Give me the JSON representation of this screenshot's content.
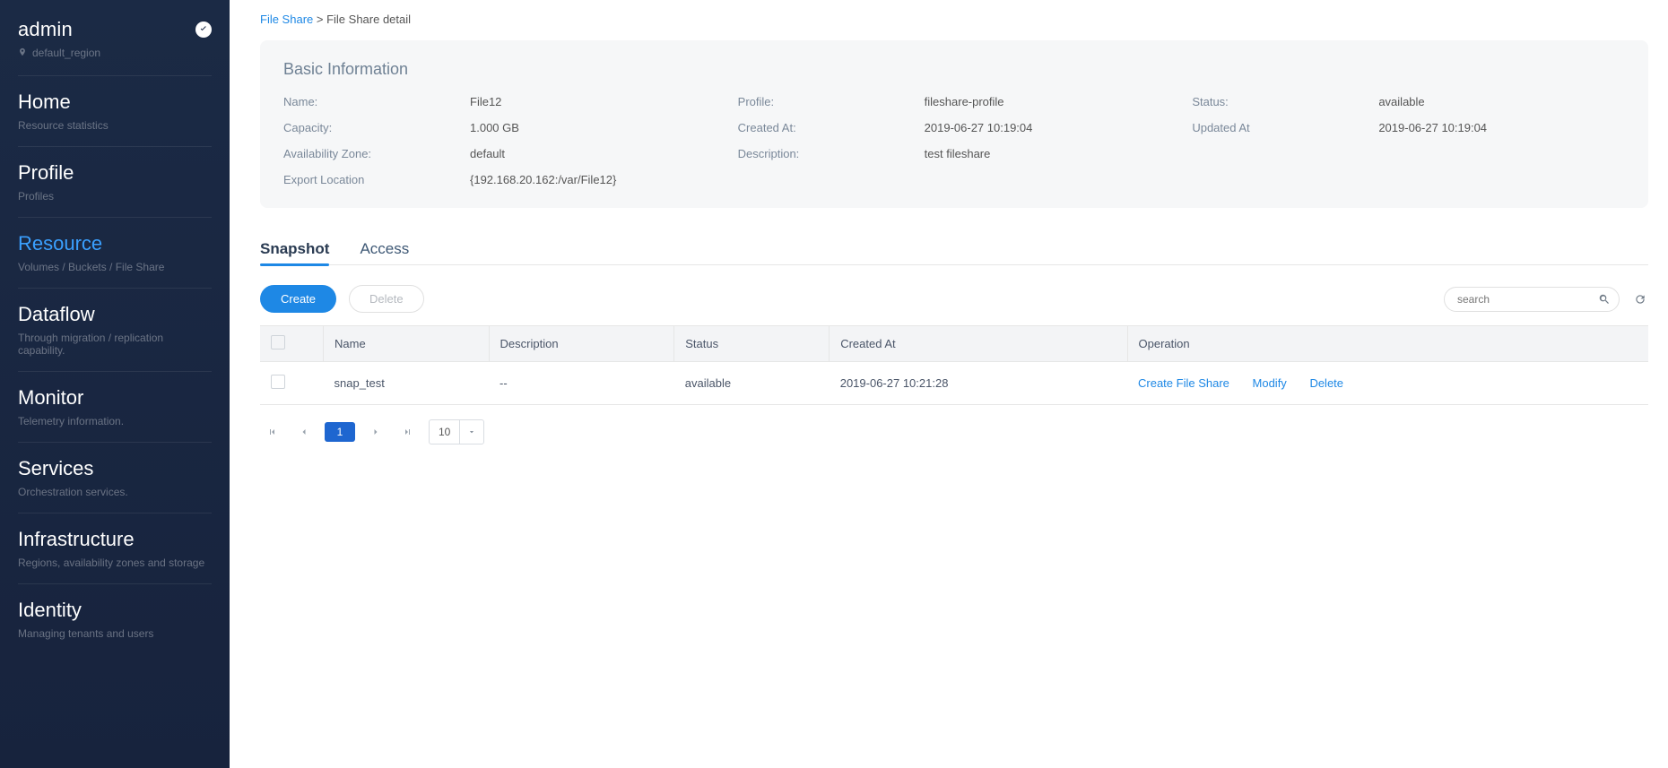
{
  "sidebar": {
    "user": "admin",
    "region": "default_region",
    "items": [
      {
        "title": "Home",
        "sub": "Resource statistics"
      },
      {
        "title": "Profile",
        "sub": "Profiles"
      },
      {
        "title": "Resource",
        "sub": "Volumes / Buckets / File Share",
        "active": "true"
      },
      {
        "title": "Dataflow",
        "sub": "Through migration / replication capability."
      },
      {
        "title": "Monitor",
        "sub": "Telemetry information."
      },
      {
        "title": "Services",
        "sub": "Orchestration services."
      },
      {
        "title": "Infrastructure",
        "sub": "Regions, availability zones and storage"
      },
      {
        "title": "Identity",
        "sub": "Managing tenants and users"
      }
    ]
  },
  "breadcrumb": {
    "root": "File Share",
    "sep": " > ",
    "current": "File Share detail"
  },
  "panel": {
    "title": "Basic Information",
    "labels": {
      "name": "Name:",
      "profile": "Profile:",
      "status": "Status:",
      "capacity": "Capacity:",
      "created": "Created At:",
      "updated": "Updated At",
      "az": "Availability Zone:",
      "desc": "Description:",
      "export": "Export Location"
    },
    "values": {
      "name": "File12",
      "profile": "fileshare-profile",
      "status": "available",
      "capacity": "1.000 GB",
      "created": "2019-06-27 10:19:04",
      "updated": "2019-06-27 10:19:04",
      "az": "default",
      "desc": "test fileshare",
      "export": "{192.168.20.162:/var/File12}"
    }
  },
  "tabs": {
    "snapshot": "Snapshot",
    "access": "Access"
  },
  "toolbar": {
    "create": "Create",
    "delete": "Delete",
    "searchPlaceholder": "search"
  },
  "table": {
    "headers": {
      "name": "Name",
      "desc": "Description",
      "status": "Status",
      "created": "Created At",
      "op": "Operation"
    },
    "rows": [
      {
        "name": "snap_test",
        "desc": "--",
        "status": "available",
        "created": "2019-06-27 10:21:28"
      }
    ],
    "ops": {
      "create": "Create File Share",
      "modify": "Modify",
      "delete": "Delete"
    }
  },
  "pager": {
    "current": "1",
    "pagesize": "10"
  }
}
